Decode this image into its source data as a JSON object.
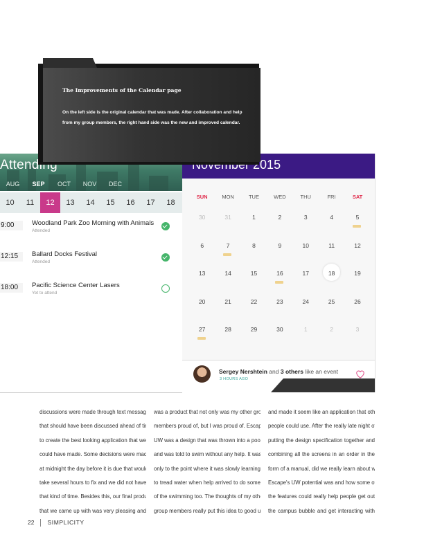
{
  "left_calendar": {
    "title": "Attending",
    "months": [
      "AUG",
      "SEP",
      "OCT",
      "NOV",
      "DEC"
    ],
    "active_month": "SEP",
    "days": [
      "10",
      "11",
      "12",
      "13",
      "14",
      "15",
      "16",
      "17",
      "18"
    ],
    "active_day": "12",
    "events": [
      {
        "time": "9:00",
        "title": "Woodland Park Zoo Morning with Animals",
        "status": "Attended",
        "done": true
      },
      {
        "time": "12:15",
        "title": "Ballard Docks Festival",
        "status": "Attended",
        "done": true
      },
      {
        "time": "18:00",
        "title": "Pacific Science Center Lasers",
        "status": "Yet to attend",
        "done": false
      }
    ]
  },
  "right_calendar": {
    "title": "November 2015",
    "accent_color": "#3b1a84",
    "weekdays": [
      "SUN",
      "MON",
      "TUE",
      "WED",
      "THU",
      "FRI",
      "SAT"
    ],
    "weeks": [
      [
        "30",
        "31",
        "1",
        "2",
        "3",
        "4",
        "5"
      ],
      [
        "6",
        "7",
        "8",
        "9",
        "10",
        "11",
        "12"
      ],
      [
        "13",
        "14",
        "15",
        "16",
        "17",
        "18",
        "19"
      ],
      [
        "20",
        "21",
        "22",
        "23",
        "24",
        "25",
        "26"
      ],
      [
        "27",
        "28",
        "29",
        "30",
        "1",
        "2",
        "3"
      ]
    ],
    "selected_date": "18",
    "marked_dates": [
      "5",
      "7",
      "16",
      "27"
    ],
    "footer": {
      "name": "Sergey Nershtein",
      "connector": "and",
      "others": "3 others",
      "action": "like an event",
      "time": "3 HOURS AGO"
    }
  },
  "caption": {
    "title": "The Improvements of the Calendar page",
    "body": "On the left side is the original calendar that was made. After collaboration and help from my group members, the right hand side was the new and improved calendar."
  },
  "article": {
    "columns": [
      [
        "discussions were made through text messages",
        "that should have been discussed ahead of time",
        "to create the best looking application that we",
        "could have made. Some decisions were made",
        "at midnight the day before it is due that would",
        "take several hours to fix and we did not have",
        "that kind of time. Besides this, our final product",
        "that we came up with was very pleasing and"
      ],
      [
        "was a product that not only was my other group",
        "members proud of, but I was proud of. Escape",
        "UW was a design that was thrown into a pool",
        "and was told to swim without any help. It was",
        "only to the point where it was slowly learning",
        "to tread water when help arrived to do some",
        "of the swimming too. The thoughts of my other",
        "group members really put this idea to good use"
      ],
      [
        "and made it seem like an application that other",
        "people could use. After the really late night of",
        "putting the design specification together and",
        "combining all the screens in an order in the",
        "form of a manual, did we really learn about what",
        "Escape's UW potential was and how some of",
        "the features could really help people get out",
        "the campus bubble and get interacting with"
      ]
    ]
  },
  "page_footer": {
    "page_number": "22",
    "magazine": "SIMPLICITY"
  }
}
